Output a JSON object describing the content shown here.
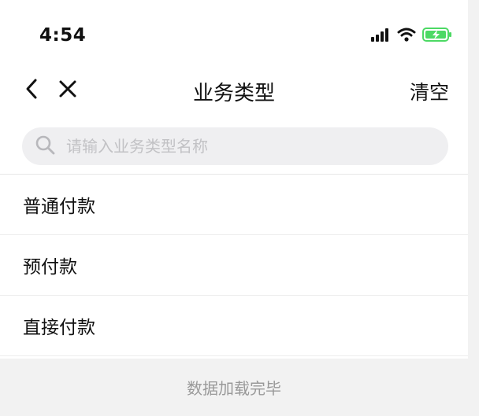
{
  "status_bar": {
    "time": "4:54",
    "icons": [
      "signal-icon",
      "wifi-icon",
      "battery-charging-icon"
    ],
    "battery_color": "#4cd964"
  },
  "nav": {
    "title": "业务类型",
    "action_label": "清空",
    "back_icon": "chevron-left-icon",
    "close_icon": "close-icon"
  },
  "search": {
    "placeholder": "请输入业务类型名称",
    "value": "",
    "icon": "search-icon"
  },
  "list": {
    "items": [
      {
        "label": "普通付款"
      },
      {
        "label": "预付款"
      },
      {
        "label": "直接付款"
      }
    ]
  },
  "footer": {
    "text": "数据加载完毕"
  }
}
